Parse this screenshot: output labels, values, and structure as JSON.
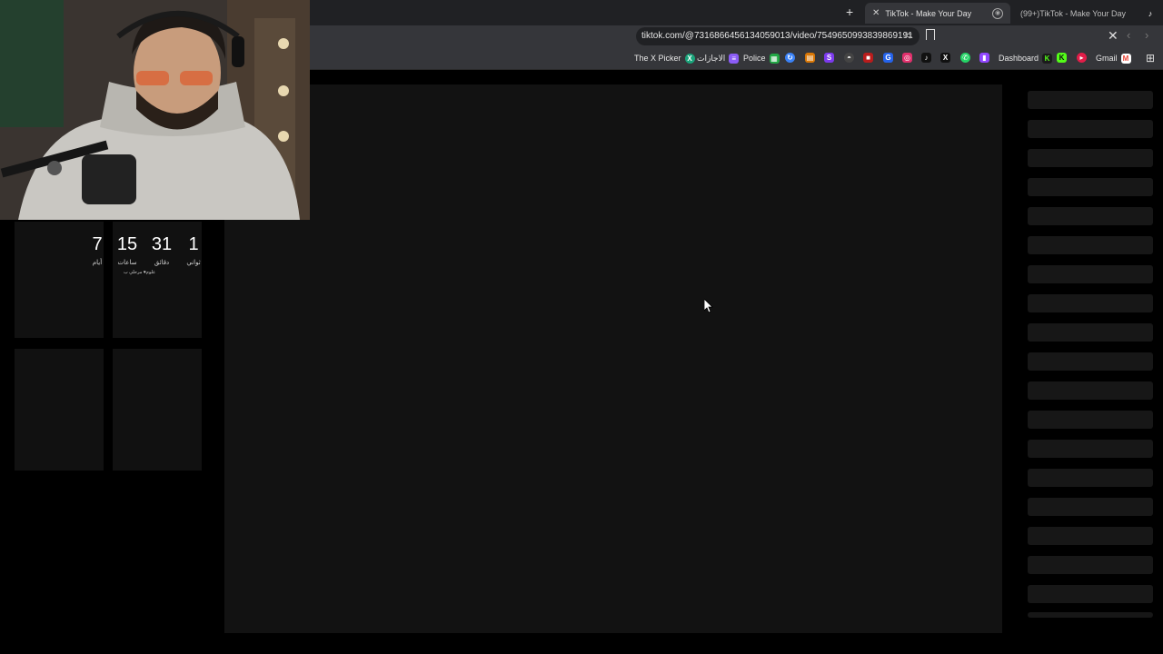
{
  "tabs": {
    "new_tab_symbol": "+",
    "active": {
      "title": "TikTok - Make Your Day",
      "close": "✕"
    },
    "inactive": {
      "title": "(99+)TikTok - Make Your Day"
    }
  },
  "address": {
    "url": "tiktok.com/@7316866456134059013/video/7549650993839869191"
  },
  "toolbar": {
    "close": "✕",
    "back": "‹",
    "forward": "›"
  },
  "bookmarks": [
    {
      "label": "The X Picker",
      "icon": "x-picker-icon",
      "color": "#1aa37a"
    },
    {
      "label": "الاجازات",
      "icon": "list-icon",
      "color": "#8b5cf6"
    },
    {
      "label": "Police",
      "icon": "sheets-icon",
      "color": "#22a845"
    },
    {
      "label": "Dashboard",
      "icon": "kick-icon",
      "color": "#53fc18"
    },
    {
      "label": "Gmail",
      "icon": "gmail-icon",
      "color": "#ea4335"
    }
  ],
  "countdown": {
    "days": "7",
    "days_label": "أيام",
    "hours": "15",
    "hours_label": "ساعات",
    "minutes": "31",
    "minutes_label": "دقائق",
    "seconds": "1",
    "seconds_label": "ثواني",
    "note": "علوم♥ مرحلي ب"
  },
  "colors": {
    "tabbar": "#202124",
    "toolbar": "#35363a",
    "player": "#121212",
    "page": "#000000"
  }
}
